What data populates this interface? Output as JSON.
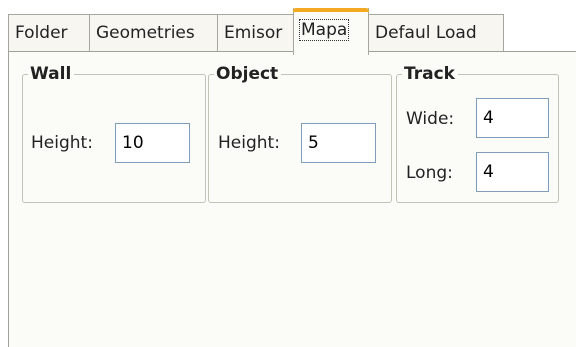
{
  "tabs": [
    {
      "label": "Folder",
      "active": false
    },
    {
      "label": "Geometries",
      "active": false
    },
    {
      "label": "Emisor",
      "active": false
    },
    {
      "label": "Mapa",
      "active": true
    },
    {
      "label": "Defaul Load",
      "active": false
    }
  ],
  "colors": {
    "active_tab_accent": "#f3a922",
    "panel_background": "#fbfbf8",
    "input_border": "#7f9db9"
  },
  "groups": {
    "wall": {
      "title": "Wall",
      "height_label": "Height:",
      "height_value": "10"
    },
    "object": {
      "title": "Object",
      "height_label": "Height:",
      "height_value": "5"
    },
    "track": {
      "title": "Track",
      "wide_label": "Wide:",
      "wide_value": "4",
      "long_label": "Long:",
      "long_value": "4"
    }
  }
}
